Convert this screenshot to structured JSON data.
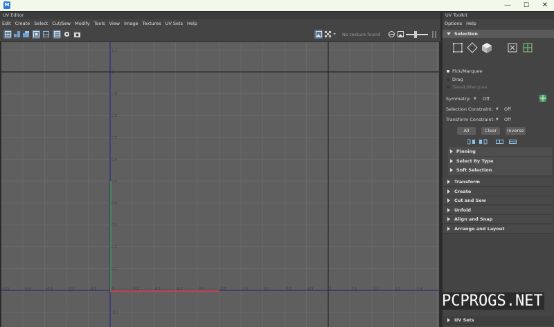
{
  "window": {
    "icon_letter": "M",
    "min_glyph": "—",
    "max_glyph": "☐",
    "close_glyph": "✕"
  },
  "uv_editor": {
    "title": "UV Editor",
    "menu": [
      "Edit",
      "Create",
      "Select",
      "Cut/Sew",
      "Modify",
      "Tools",
      "View",
      "Image",
      "Textures",
      "UV Sets",
      "Help"
    ],
    "toolbar": {
      "texture_status": "No texture found"
    },
    "grid": {
      "x_ticks": [
        "-0.5",
        "-0.4",
        "-0.3",
        "-0.2",
        "-0.1",
        "0",
        "0.1",
        "0.2",
        "0.3",
        "0.4",
        "0.5",
        "0.6",
        "0.7",
        "0.8",
        "0.9",
        "1",
        "1.1",
        "1.2",
        "1.3",
        "1.4"
      ],
      "y_ticks": [
        "1.1",
        "1",
        "0.9",
        "0.8",
        "0.7",
        "0.6",
        "0.5",
        "0.4",
        "0.3",
        "0.2",
        "0.1",
        "-0.1"
      ]
    }
  },
  "uv_toolkit": {
    "title": "UV Toolkit",
    "menu": [
      "Options",
      "Help"
    ],
    "selection": {
      "header": "Selection",
      "modes": [
        "Pick/Marquee",
        "Drag",
        "Tweak/Marquee"
      ],
      "symmetry_label": "Symmetry:",
      "symmetry_value": "Off",
      "sel_constraint_label": "Selection Constraint:",
      "sel_constraint_value": "Off",
      "xform_constraint_label": "Transform Constraint:",
      "xform_constraint_value": "Off",
      "buttons": [
        "All",
        "Clear",
        "Inverse"
      ],
      "subsections": [
        "Pinning",
        "Select By Type",
        "Soft Selection"
      ]
    },
    "sections": [
      "Transform",
      "Create",
      "Cut and Sew",
      "Unfold",
      "Align and Snap",
      "Arrange and Layout"
    ],
    "uv_sets": "UV Sets"
  },
  "watermark": "PCPROGS.NET",
  "colors": {
    "viewport_bg": "#5f5f5f",
    "axis_u": "#c44949",
    "axis_v": "#4fa04f",
    "grid_border": "#1f1f8a"
  }
}
